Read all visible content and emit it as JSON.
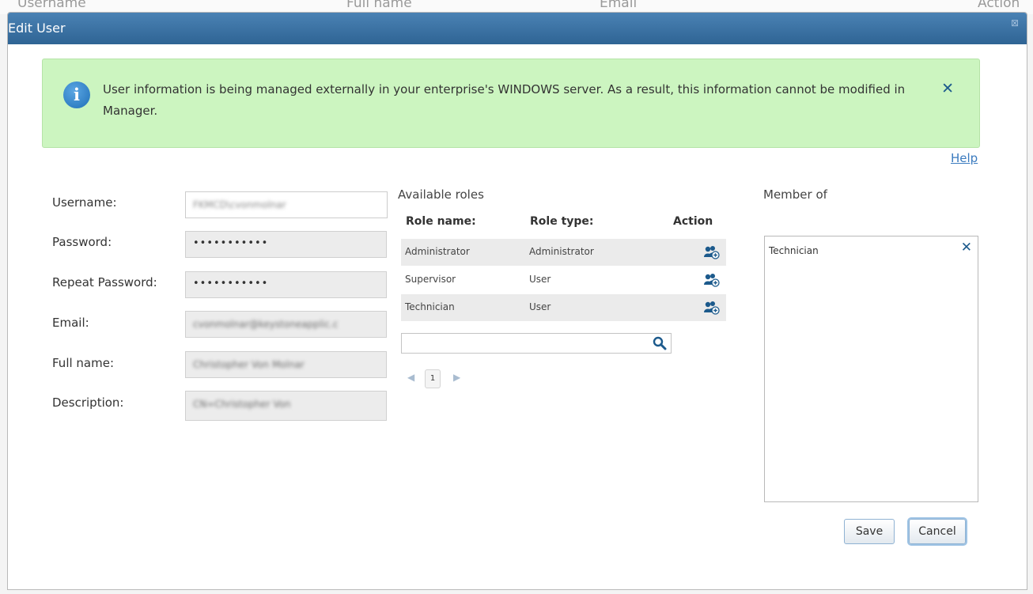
{
  "background_table": {
    "columns": [
      "Username",
      "Full name",
      "Email",
      "Action"
    ]
  },
  "dialog": {
    "title": "Edit User",
    "close_glyph": "⊠"
  },
  "notice": {
    "icon": "info-icon",
    "icon_glyph": "i",
    "text": "User information is being managed externally in your enterprise's WINDOWS server. As a result, this information cannot be modified in Manager.",
    "close_glyph": "✕"
  },
  "help_label": "Help",
  "form": {
    "username": {
      "label": "Username:",
      "value": "FKMCD\\cvonmolnar"
    },
    "password": {
      "label": "Password:",
      "value": "•••••••••••"
    },
    "repeat_password": {
      "label": "Repeat Password:",
      "value": "•••••••••••"
    },
    "email": {
      "label": "Email:",
      "value": "cvonmolnar@keystoneapplic.c"
    },
    "full_name": {
      "label": "Full name:",
      "value": "Christopher Von Molnar"
    },
    "description": {
      "label": "Description:",
      "value": "CN=Christopher Von"
    }
  },
  "roles": {
    "title": "Available roles",
    "headers": {
      "name": "Role name:",
      "type": "Role type:",
      "action": "Action"
    },
    "rows": [
      {
        "name": "Administrator",
        "type": "Administrator",
        "action_icon": "add-user-icon"
      },
      {
        "name": "Supervisor",
        "type": "User",
        "action_icon": "add-user-icon"
      },
      {
        "name": "Technician",
        "type": "User",
        "action_icon": "add-user-icon"
      }
    ],
    "search": {
      "value": "",
      "placeholder": "",
      "icon": "search-icon"
    },
    "pagination": {
      "prev_glyph": "◀",
      "page": "1",
      "next_glyph": "▶"
    }
  },
  "member_of": {
    "title": "Member of",
    "items": [
      {
        "name": "Technician",
        "remove_glyph": "✕"
      }
    ]
  },
  "buttons": {
    "save": "Save",
    "cancel": "Cancel"
  },
  "colors": {
    "titlebar": "#2f6494",
    "notice_bg": "#ccf5c0",
    "link": "#3b7bbf",
    "accent_icon": "#1c5a8c"
  }
}
